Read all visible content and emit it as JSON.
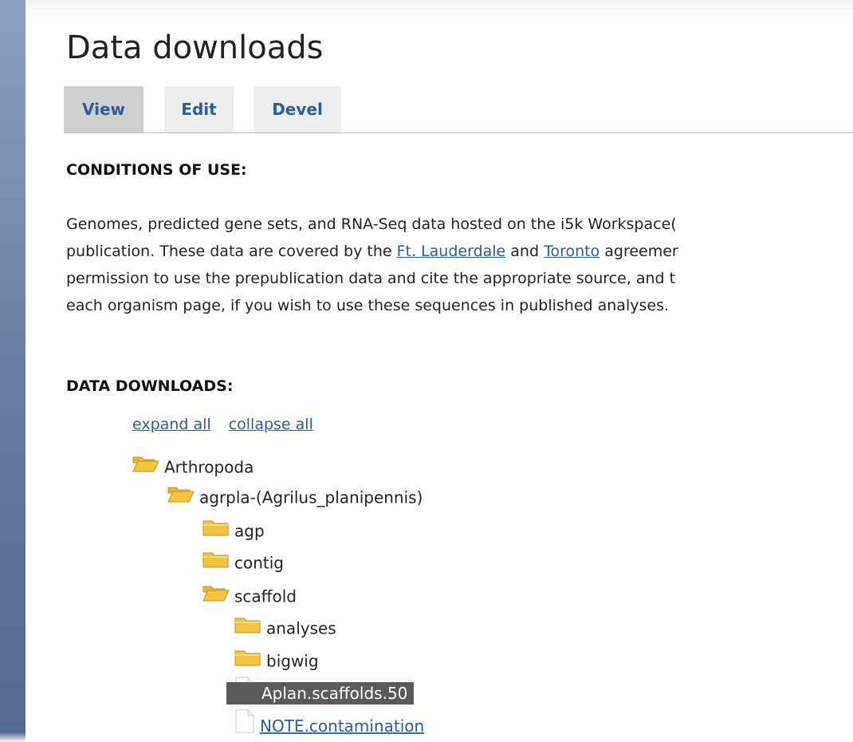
{
  "page": {
    "title": "Data downloads"
  },
  "tabs": [
    {
      "label": "View",
      "active": true
    },
    {
      "label": "Edit",
      "active": false
    },
    {
      "label": "Devel",
      "active": false
    }
  ],
  "conditions": {
    "heading": "CONDITIONS OF USE:",
    "line1": "Genomes, predicted gene sets, and RNA-Seq data hosted on the i5k Workspace(",
    "line2_a": "publication. These data are covered by the ",
    "link_ft_lauderdale": "Ft. Lauderdale",
    "line2_b": " and ",
    "link_toronto": "Toronto",
    "line2_c": " agreemer",
    "line3": "permission to use the prepublication data and cite the appropriate source, and t",
    "line4": "each organism page, if you wish to use these sequences in published analyses."
  },
  "downloads": {
    "heading": "DATA DOWNLOADS:",
    "expand_all": "expand all",
    "collapse_all": "collapse all"
  },
  "tree": [
    {
      "label": "Arthropoda",
      "icon": "folder-open-icon"
    },
    {
      "label": "agrpla-(Agrilus_planipennis)",
      "icon": "folder-open-icon"
    },
    {
      "label": "agp",
      "icon": "folder-closed-icon"
    },
    {
      "label": "contig",
      "icon": "folder-closed-icon"
    },
    {
      "label": "scaffold",
      "icon": "folder-open-icon"
    },
    {
      "label": "analyses",
      "icon": "folder-closed-icon"
    },
    {
      "label": "bigwig",
      "icon": "folder-closed-icon"
    },
    {
      "label": "Aplan.scaffolds.50",
      "icon": "file-icon",
      "selected": true
    },
    {
      "label": "NOTE.contamination",
      "icon": "file-icon"
    }
  ],
  "colors": {
    "link": "#2a5d9c",
    "tab_active": "#cfcfcf",
    "tab_inactive": "#eeeeee",
    "selection": "#5a5a5a",
    "folder": "#f5c542"
  }
}
